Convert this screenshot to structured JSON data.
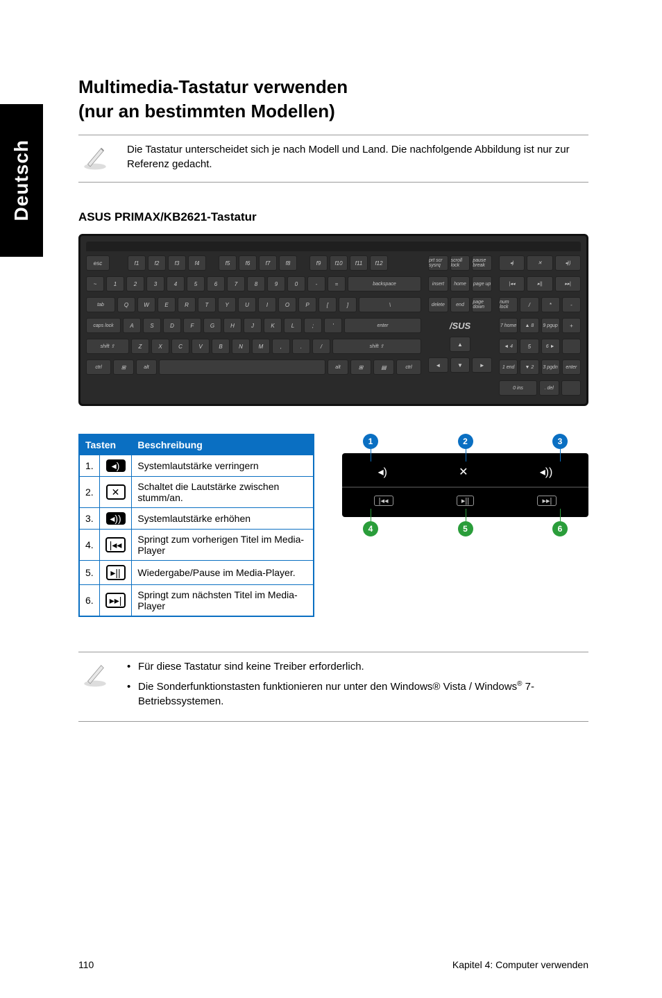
{
  "side_tab": "Deutsch",
  "title": "Multimedia-Tastatur verwenden",
  "subtitle": "(nur an bestimmten Modellen)",
  "note1": "Die Tastatur unterscheidet sich je nach Modell und Land. Die nachfolgende Abbildung ist nur zur Referenz gedacht.",
  "kb_heading": "ASUS PRIMAX/KB2621-Tastatur",
  "keys": {
    "esc": "esc",
    "f1": "f1",
    "f2": "f2",
    "f3": "f3",
    "f4": "f4",
    "f5": "f5",
    "f6": "f6",
    "f7": "f7",
    "f8": "f8",
    "f9": "f9",
    "f10": "f10",
    "f11": "f11",
    "f12": "f12",
    "prtsc": "prt scr sysrq",
    "scroll": "scroll lock",
    "pause": "pause break",
    "tilde": "~",
    "k1": "1",
    "k2": "2",
    "k3": "3",
    "k4": "4",
    "k5": "5",
    "k6": "6",
    "k7": "7",
    "k8": "8",
    "k9": "9",
    "k0": "0",
    "minus": "-",
    "equal": "=",
    "back": "backspace",
    "tab": "tab",
    "q": "Q",
    "w": "W",
    "e": "E",
    "r": "R",
    "t": "T",
    "y": "Y",
    "u": "U",
    "i": "I",
    "o": "O",
    "p": "P",
    "lbr": "[",
    "rbr": "]",
    "bslash": "\\",
    "caps": "caps lock",
    "a": "A",
    "s": "S",
    "d": "D",
    "f": "F",
    "g": "G",
    "h": "H",
    "j": "J",
    "k": "K",
    "l": "L",
    "semi": ";",
    "quote": "'",
    "enter": "enter",
    "lshift": "shift ⇧",
    "z": "Z",
    "x": "X",
    "c": "C",
    "v": "V",
    "b": "B",
    "n": "N",
    "m": "M",
    "comma": ",",
    "period": ".",
    "slash": "/",
    "rshift": "shift ⇧",
    "lctrl": "ctrl",
    "lwin": "⊞",
    "lalt": "alt",
    "ralt": "alt",
    "rwin": "⊞",
    "menu": "▤",
    "rctrl": "ctrl",
    "ins": "insert",
    "home": "home",
    "pgup": "page up",
    "del": "delete",
    "end": "end",
    "pgdn": "page down",
    "up": "▲",
    "left": "◄",
    "down": "▼",
    "right": "►",
    "numlock": "num lock",
    "ndiv": "/",
    "nmul": "*",
    "nmin": "-",
    "n7": "7 home",
    "n8": "▲ 8",
    "n9": "9 pgup",
    "nplus": "+",
    "n4": "◄ 4",
    "n5": "5",
    "n6": "6 ►",
    "n1": "1 end",
    "n2": "▼ 2",
    "n3": "3 pgdn",
    "nent": "enter",
    "n0": "0 ins",
    "ndot": ". del",
    "m1": "◂)",
    "m2": "✕",
    "m3": "◂))",
    "m4": "|◂◂",
    "m5": "▸||",
    "m6": "▸▸|",
    "asus": "/SUS"
  },
  "table": {
    "h1": "Tasten",
    "h2": "Beschreibung",
    "rows": [
      {
        "n": "1.",
        "d": "Systemlautstärke verringern"
      },
      {
        "n": "2.",
        "d": "Schaltet die Lautstärke zwischen stumm/an."
      },
      {
        "n": "3.",
        "d": "Systemlautstärke erhöhen"
      },
      {
        "n": "4.",
        "d": "Springt zum vorherigen Titel im Media-Player"
      },
      {
        "n": "5.",
        "d": "Wiedergabe/Pause im Media-Player."
      },
      {
        "n": "6.",
        "d": "Springt zum nächsten Titel im Media-Player"
      }
    ]
  },
  "callouts": {
    "c1": "1",
    "c2": "2",
    "c3": "3",
    "c4": "4",
    "c5": "5",
    "c6": "6"
  },
  "panel": {
    "i1": "◂)",
    "i2": "✕",
    "i3": "◂))",
    "i4": "|◂◂",
    "i5": "▸||",
    "i6": "▸▸|"
  },
  "note2_a": "Für diese Tastatur sind keine Treiber erforderlich.",
  "note2_b_1": "Die Sonderfunktionstasten funktionieren nur unter den Windows® Vista / Windows",
  "note2_b_sup": "®",
  "note2_b_2": " 7-Betriebssystemen.",
  "footer_left": "110",
  "footer_right": "Kapitel 4: Computer verwenden"
}
